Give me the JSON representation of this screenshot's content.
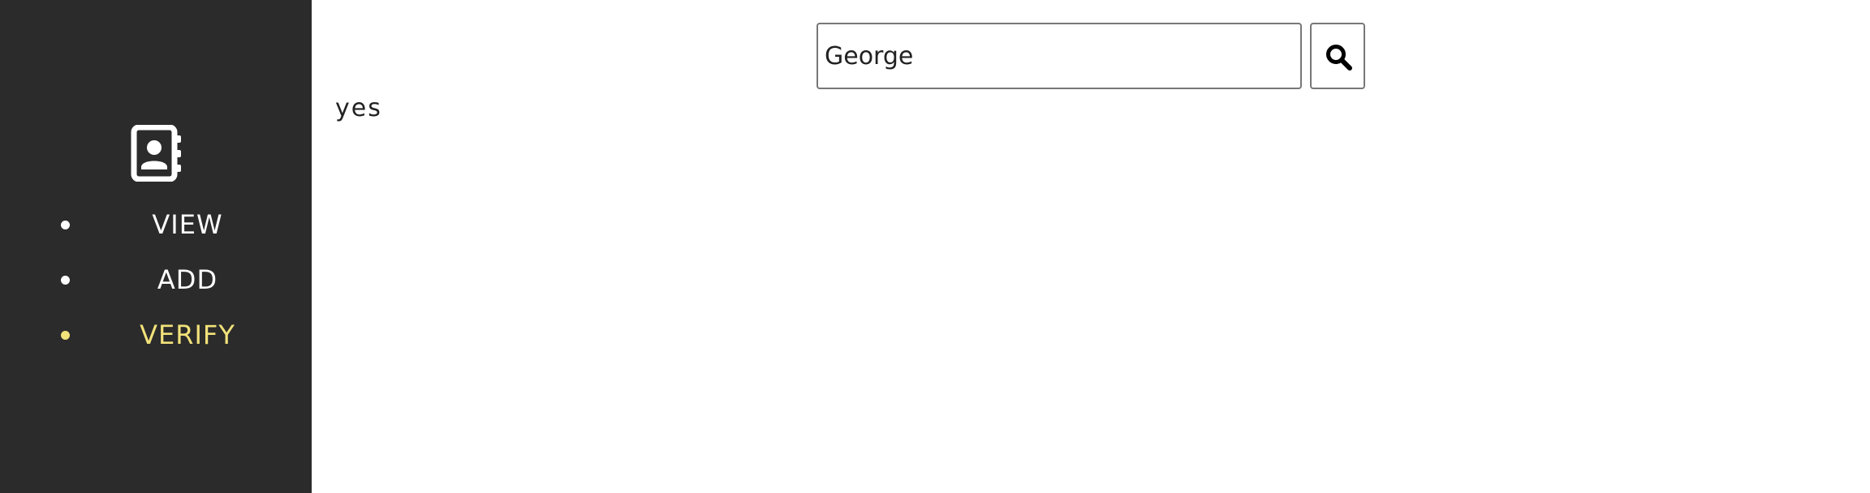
{
  "sidebar": {
    "logo_icon": "address-book-icon",
    "items": [
      {
        "label": "VIEW",
        "active": false
      },
      {
        "label": "ADD",
        "active": false
      },
      {
        "label": "VERIFY",
        "active": true
      }
    ],
    "active_color": "#f2e27a",
    "background_color": "#2b2b2b"
  },
  "search": {
    "value": "George",
    "icon": "search-icon"
  },
  "result": {
    "text": "yes"
  }
}
